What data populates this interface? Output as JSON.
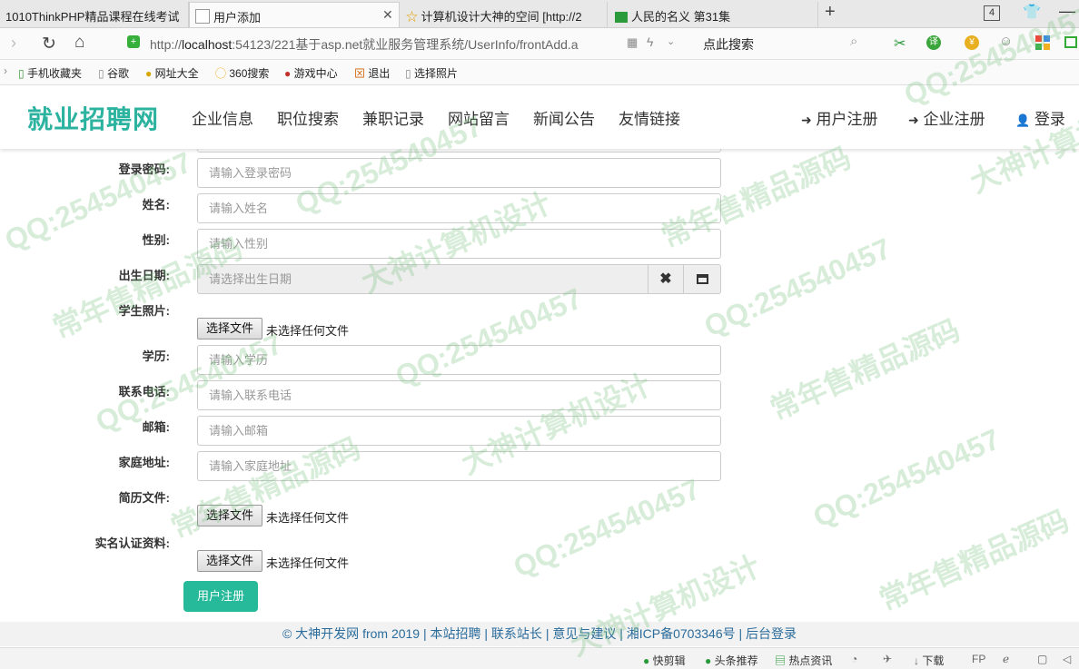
{
  "browser": {
    "tabs": [
      {
        "title": "1010ThinkPHP精品课程在线考试"
      },
      {
        "title": "用户添加"
      },
      {
        "title": "计算机设计大神的空间 [http://2"
      },
      {
        "title": "人民的名义 第31集"
      }
    ],
    "tab_count": "4",
    "url_prefix": "http://",
    "url_host": "localhost",
    "url_rest": ":54123/221基于asp.net就业服务管理系统/UserInfo/frontAdd.a",
    "search_label": "点此搜索",
    "bookmarks": [
      "手机收藏夹",
      "谷歌",
      "网址大全",
      "360搜索",
      "游戏中心",
      "退出",
      "选择照片"
    ]
  },
  "site": {
    "logo": "就业招聘网",
    "nav": [
      "企业信息",
      "职位搜索",
      "兼职记录",
      "网站留言",
      "新闻公告",
      "友情链接"
    ],
    "right_nav": [
      "用户注册",
      "企业注册",
      "登录"
    ]
  },
  "form": {
    "password": {
      "label": "登录密码:",
      "placeholder": "请输入登录密码"
    },
    "name": {
      "label": "姓名:",
      "placeholder": "请输入姓名"
    },
    "gender": {
      "label": "性别:",
      "placeholder": "请输入性别"
    },
    "birthday": {
      "label": "出生日期:",
      "placeholder": "请选择出生日期"
    },
    "photo": {
      "label": "学生照片:",
      "button": "选择文件",
      "status": "未选择任何文件"
    },
    "education": {
      "label": "学历:",
      "placeholder": "请输入学历"
    },
    "phone": {
      "label": "联系电话:",
      "placeholder": "请输入联系电话"
    },
    "email": {
      "label": "邮箱:",
      "placeholder": "请输入邮箱"
    },
    "address": {
      "label": "家庭地址:",
      "placeholder": "请输入家庭地址"
    },
    "resume": {
      "label": "简历文件:",
      "button": "选择文件",
      "status": "未选择任何文件"
    },
    "realname": {
      "label": "实名认证资料:",
      "button": "选择文件",
      "status": "未选择任何文件"
    },
    "submit": "用户注册"
  },
  "footer": {
    "text": "© 大神开发网 from 2019 | 本站招聘 | 联系站长 | 意见与建议 | 湘ICP备0703346号 | 后台登录"
  },
  "statusbar": {
    "items": [
      "快剪辑",
      "头条推荐",
      "热点资讯",
      "下载"
    ]
  },
  "watermark": {
    "texts": [
      "QQ:254540457",
      "常年售精品源码",
      "大神计算机设计"
    ]
  },
  "colors": {
    "brand": "#2cb3a0",
    "button": "#26b99a",
    "footer_link": "#2a6c9c"
  }
}
